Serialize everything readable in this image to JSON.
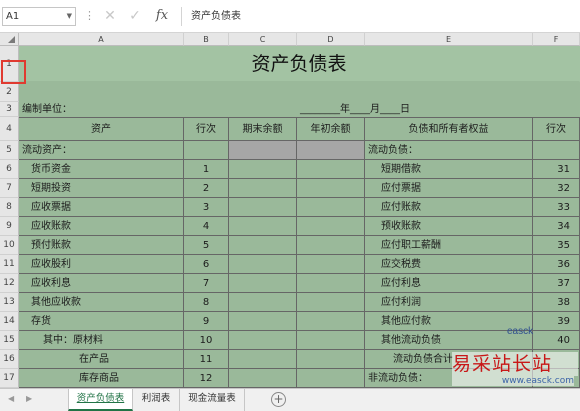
{
  "formula_bar": {
    "name_box": "A1",
    "content": "资产负债表"
  },
  "columns": [
    "A",
    "B",
    "C",
    "D",
    "E",
    "F"
  ],
  "rows": [
    "1",
    "2",
    "3",
    "4",
    "5",
    "6",
    "7",
    "8",
    "9",
    "10",
    "11",
    "12",
    "13",
    "14",
    "15",
    "16",
    "17"
  ],
  "sheet": {
    "title": "资产负债表",
    "unit_label": "编制单位：",
    "date_label": "________年____月____日",
    "headers": {
      "asset": "资产",
      "line_no": "行次",
      "end_balance": "期末余额",
      "begin_balance": "年初余额",
      "liab": "负债和所有者权益",
      "line_no2": "行次"
    },
    "left_rows": [
      {
        "name": "流动资产：",
        "no": ""
      },
      {
        "name": "货币资金",
        "no": "1"
      },
      {
        "name": "短期投资",
        "no": "2"
      },
      {
        "name": "应收票据",
        "no": "3"
      },
      {
        "name": "应收账款",
        "no": "4"
      },
      {
        "name": "预付账款",
        "no": "5"
      },
      {
        "name": "应收股利",
        "no": "6"
      },
      {
        "name": "应收利息",
        "no": "7"
      },
      {
        "name": "其他应收款",
        "no": "8"
      },
      {
        "name": "存货",
        "no": "9"
      },
      {
        "name": "其中：原材料",
        "no": "10"
      },
      {
        "name": "在产品",
        "no": "11"
      },
      {
        "name": "库存商品",
        "no": "12"
      }
    ],
    "right_rows": [
      {
        "name": "流动负债：",
        "no": ""
      },
      {
        "name": "短期借款",
        "no": "31"
      },
      {
        "name": "应付票据",
        "no": "32"
      },
      {
        "name": "应付账款",
        "no": "33"
      },
      {
        "name": "预收账款",
        "no": "34"
      },
      {
        "name": "应付职工薪酬",
        "no": "35"
      },
      {
        "name": "应交税费",
        "no": "36"
      },
      {
        "name": "应付利息",
        "no": "37"
      },
      {
        "name": "应付利润",
        "no": "38"
      },
      {
        "name": "其他应付款",
        "no": "39"
      },
      {
        "name": "其他流动负债",
        "no": "40"
      },
      {
        "name": "流动负债合计",
        "no": ""
      },
      {
        "name": "非流动负债：",
        "no": ""
      }
    ]
  },
  "tabs": [
    "资产负债表",
    "利润表",
    "现金流量表"
  ],
  "watermark": {
    "text": "易采站长站",
    "url": "www.easck.com",
    "fragment": "easck"
  },
  "colors": {
    "cell_fill": "#9ab99a",
    "title_fill": "#a3c3a3",
    "header_fill": "#e6e6e6",
    "accent_tab": "#217346",
    "highlight_border": "#e03a30"
  }
}
